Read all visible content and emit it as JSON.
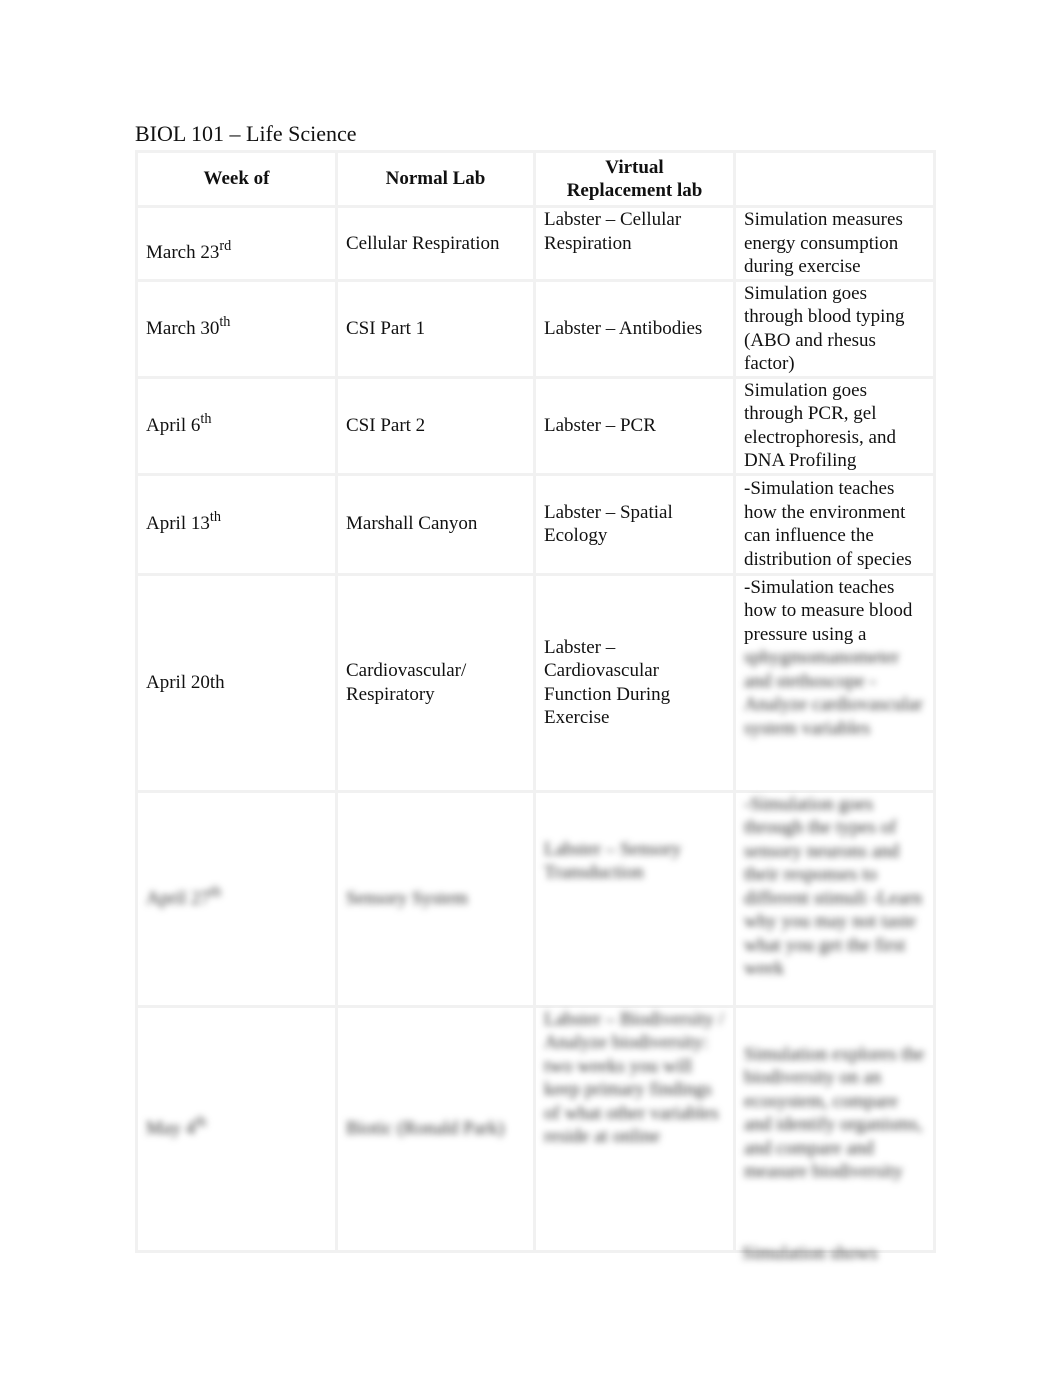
{
  "document": {
    "title": "BIOL 101 – Life Science"
  },
  "table": {
    "headers": {
      "week": "Week of",
      "normal": "Normal Lab",
      "virtual": "Virtual Replacement lab",
      "description": ""
    },
    "rows": [
      {
        "week": "March 23",
        "week_suffix": "rd",
        "normal": "Cellular Respiration",
        "virtual": "Labster – Cellular Respiration",
        "description": "Simulation measures energy consumption during exercise"
      },
      {
        "week": "March 30",
        "week_suffix": "th",
        "normal": "CSI Part 1",
        "virtual": "Labster – Antibodies",
        "description": "Simulation goes through blood typing (ABO and rhesus factor)"
      },
      {
        "week": "April 6",
        "week_suffix": "th",
        "normal": "CSI Part 2",
        "virtual": "Labster – PCR",
        "description": "Simulation goes through PCR, gel electrophoresis, and DNA Profiling"
      },
      {
        "week": "April 13",
        "week_suffix": "th",
        "normal": "Marshall Canyon",
        "virtual": "Labster – Spatial Ecology",
        "description": "-Simulation teaches how the environment can influence the distribution of species"
      },
      {
        "week": "April 20th",
        "week_suffix": "",
        "normal": "Cardiovascular/ Respiratory",
        "virtual": "Labster – Cardiovascular Function During Exercise",
        "description": "-Simulation teaches how to measure blood pressure using a",
        "description_blurred": "sphygmomanometer and stethoscope - Analyze cardiovascular system variables"
      },
      {
        "week": "April 27",
        "week_suffix": "th",
        "normal": "Sensory System",
        "virtual": "Labster – Sensory Transduction",
        "description": "",
        "description_blurred": "-Simulation goes through the types of sensory neurons and their responses to different stimuli -Learn why you may not taste what you get the first week",
        "blurred": true
      },
      {
        "week": "May 4",
        "week_suffix": "th",
        "normal": "Biotic (Ronald Park)",
        "virtual": "",
        "virtual_blurred": "Labster – Biodiversity / Analyze biodiversity: two weeks you will keep primary findings of what other variables reside at online",
        "description": "",
        "description_blurred": "Simulation explores the biodiversity on an ecosystem, compare and identify organisms, and compare and measure biodiversity",
        "description_tail_blurred": "Simulation shows",
        "blurred": true
      }
    ]
  }
}
